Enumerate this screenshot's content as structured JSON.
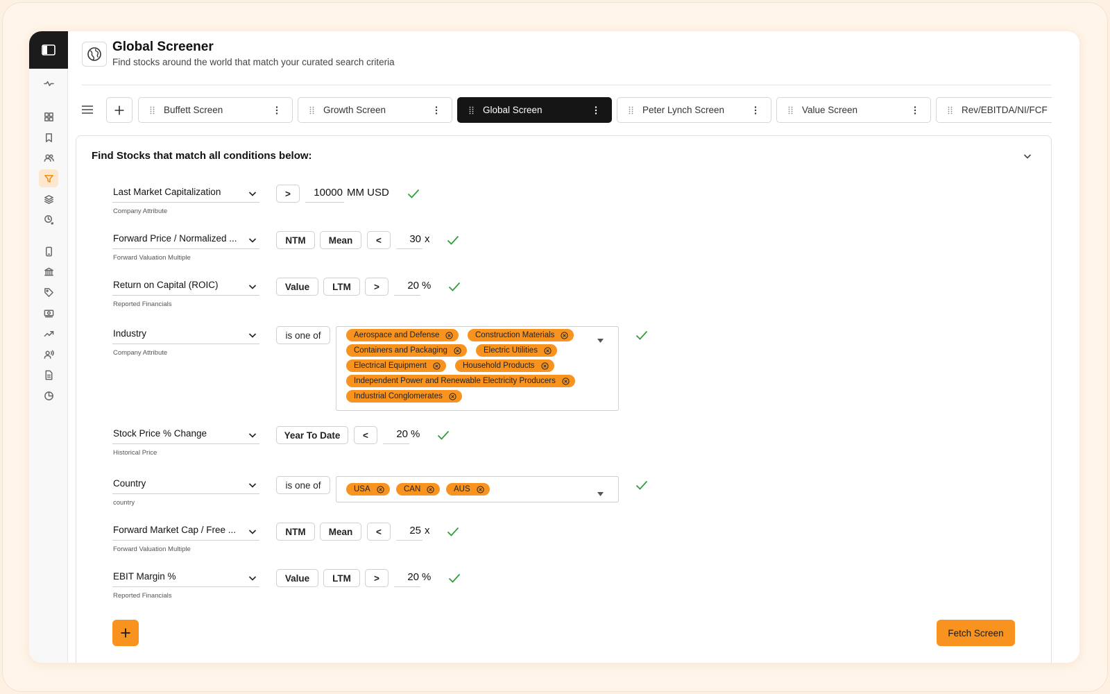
{
  "header": {
    "title": "Global Screener",
    "subtitle": "Find stocks around the world that match your curated search criteria"
  },
  "tabs": [
    {
      "label": "Buffett Screen",
      "active": false
    },
    {
      "label": "Growth Screen",
      "active": false
    },
    {
      "label": "Global Screen",
      "active": true
    },
    {
      "label": "Peter Lynch Screen",
      "active": false
    },
    {
      "label": "Value Screen",
      "active": false
    },
    {
      "label": "Rev/EBITDA/NI/FCF",
      "active": false
    }
  ],
  "panel": {
    "title": "Find Stocks that match all conditions below:"
  },
  "conditions": [
    {
      "field": "Last Market Capitalization",
      "category": "Company Attribute",
      "operator": ">",
      "value": "10000",
      "unit": "MM USD"
    },
    {
      "field": "Forward Price / Normalized ...",
      "category": "Forward Valuation Multiple",
      "period": "NTM",
      "stat": "Mean",
      "operator": "<",
      "value": "30",
      "unit": "x"
    },
    {
      "field": "Return on Capital (ROIC)",
      "category": "Reported Financials",
      "stat": "Value",
      "period": "LTM",
      "operator": ">",
      "value": "20",
      "unit": "%"
    },
    {
      "field": "Industry",
      "category": "Company Attribute",
      "operator": "is one of",
      "values": [
        "Aerospace and Defense",
        "Construction Materials",
        "Containers and Packaging",
        "Electric Utilities",
        "Electrical Equipment",
        "Household Products",
        "Independent Power and Renewable Electricity Producers",
        "Industrial Conglomerates"
      ]
    },
    {
      "field": "Stock Price % Change",
      "category": "Historical Price",
      "period": "Year To Date",
      "operator": "<",
      "value": "20",
      "unit": "%"
    },
    {
      "field": "Country",
      "category": "country",
      "operator": "is one of",
      "values": [
        "USA",
        "CAN",
        "AUS"
      ]
    },
    {
      "field": "Forward Market Cap / Free ...",
      "category": "Forward Valuation Multiple",
      "period": "NTM",
      "stat": "Mean",
      "operator": "<",
      "value": "25",
      "unit": "x"
    },
    {
      "field": "EBIT Margin %",
      "category": "Reported Financials",
      "stat": "Value",
      "period": "LTM",
      "operator": ">",
      "value": "20",
      "unit": "%"
    }
  ],
  "actions": {
    "fetch_label": "Fetch Screen"
  },
  "colors": {
    "accent": "#f7931e",
    "active_tab": "#151515",
    "check": "#2e9e3a"
  }
}
